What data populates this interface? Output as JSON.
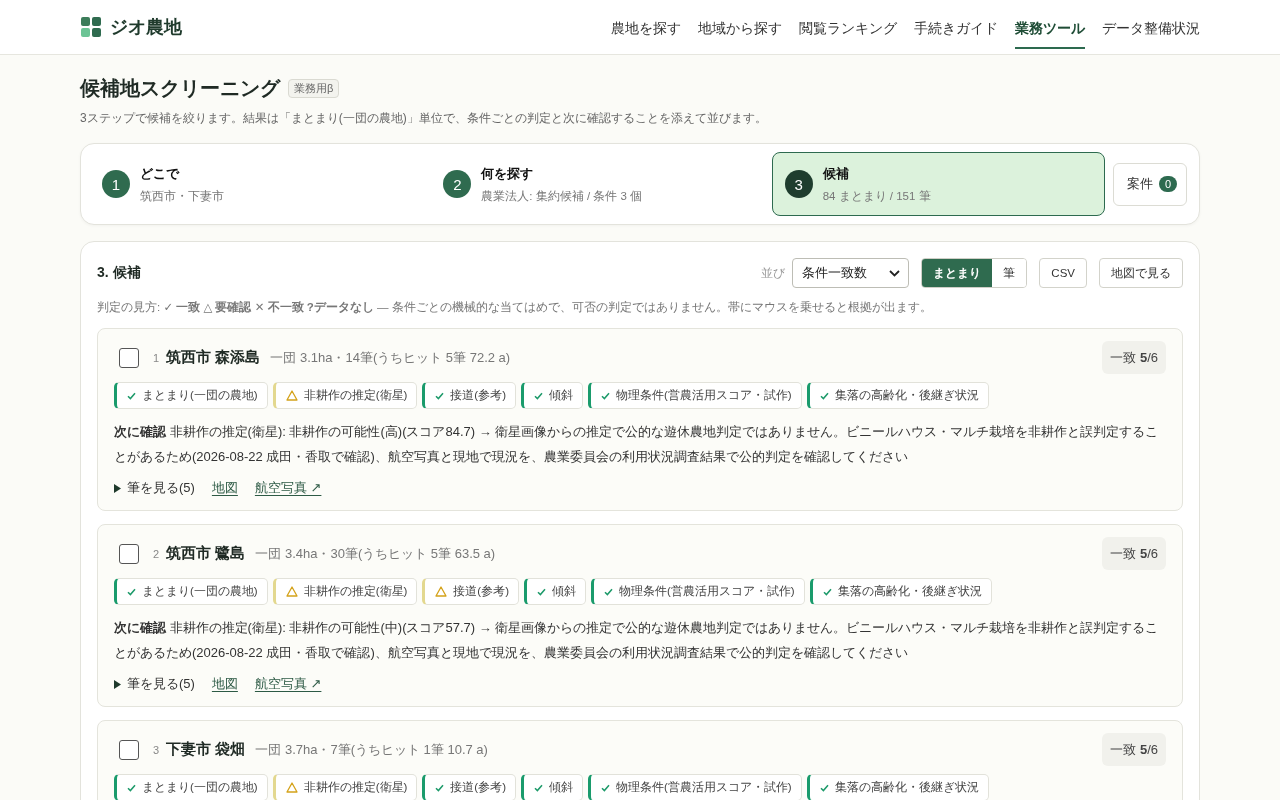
{
  "header": {
    "logo": "ジオ農地",
    "nav": [
      {
        "label": "農地を探す",
        "selected": false
      },
      {
        "label": "地域から探す",
        "selected": false
      },
      {
        "label": "閲覧ランキング",
        "selected": false
      },
      {
        "label": "手続きガイド",
        "selected": false
      },
      {
        "label": "業務ツール",
        "selected": true
      },
      {
        "label": "データ整備状況",
        "selected": false
      }
    ]
  },
  "page": {
    "title": "候補地スクリーニング",
    "badge": "業務用β",
    "description": "3ステップで候補を絞ります。結果は「まとまり(一団の農地)」単位で、条件ごとの判定と次に確認することを添えて並びます。"
  },
  "steps": [
    {
      "number": "1",
      "title": "どこで",
      "detail": "筑西市・下妻市",
      "selected": false
    },
    {
      "number": "2",
      "title": "何を探す",
      "detail": "農業法人: 集約候補 / 条件 3 個",
      "selected": false
    },
    {
      "number": "3",
      "title": "候補",
      "detail": "84 まとまり / 151 筆",
      "selected": true
    }
  ],
  "cases_button": {
    "label": "案件",
    "count": "0"
  },
  "results": {
    "title": "3. 候補",
    "sort": {
      "label": "並び",
      "value": "条件一致数"
    },
    "view_toggle": [
      {
        "label": "まとまり",
        "selected": true
      },
      {
        "label": "筆",
        "selected": false
      }
    ],
    "buttons": [
      "CSV",
      "地図で見る"
    ],
    "legend": "判定の見方: **✓ 一致** **△ 要確認** **✕ 不一致** **?データなし** — 条件ごとの機械的な当てはめで、可否の判定ではありません。帯にマウスを乗せると根拠が出ます。",
    "items": [
      {
        "index": "1",
        "checked": false,
        "name": "筑西市 森添島",
        "meta": "一団 3.1ha・14筆(うちヒット 5筆 72.2 a)",
        "score": "一致 **5**/6",
        "chips": [
          {
            "label": "まとまり(一団の農地)",
            "kind": "match"
          },
          {
            "label": "非耕作の推定(衛星)",
            "kind": "check"
          },
          {
            "label": "接道(参考)",
            "kind": "match"
          },
          {
            "label": "傾斜",
            "kind": "match"
          },
          {
            "label": "物理条件(営農活用スコア・試作)",
            "kind": "match"
          },
          {
            "label": "集落の高齢化・後継ぎ状況",
            "kind": "match"
          }
        ],
        "next_check": "**次に確認** 非耕作の推定(衛星): 非耕作の可能性(高)(スコア84.7) → 衛星画像からの推定で公的な遊休農地判定ではありません。ビニールハウス・マルチ栽培を非耕作と誤判定することがあるため(2026-08-22 成田・香取で確認)、航空写真と現地で現況を、農業委員会の利用状況調査結果で公的判定を確認してください",
        "expand": "筆を見る(5)",
        "map_link": "地図",
        "aerial_photo_link": "航空写真 ↗"
      },
      {
        "index": "2",
        "checked": false,
        "name": "筑西市 鷺島",
        "meta": "一団 3.4ha・30筆(うちヒット 5筆 63.5 a)",
        "score": "一致 **5**/6",
        "chips": [
          {
            "label": "まとまり(一団の農地)",
            "kind": "match"
          },
          {
            "label": "非耕作の推定(衛星)",
            "kind": "check"
          },
          {
            "label": "接道(参考)",
            "kind": "check"
          },
          {
            "label": "傾斜",
            "kind": "match"
          },
          {
            "label": "物理条件(営農活用スコア・試作)",
            "kind": "match"
          },
          {
            "label": "集落の高齢化・後継ぎ状況",
            "kind": "match"
          }
        ],
        "next_check": "**次に確認** 非耕作の推定(衛星): 非耕作の可能性(中)(スコア57.7) → 衛星画像からの推定で公的な遊休農地判定ではありません。ビニールハウス・マルチ栽培を非耕作と誤判定することがあるため(2026-08-22 成田・香取で確認)、航空写真と現地で現況を、農業委員会の利用状況調査結果で公的判定を確認してください",
        "expand": "筆を見る(5)",
        "map_link": "地図",
        "aerial_photo_link": "航空写真 ↗"
      },
      {
        "index": "3",
        "checked": false,
        "name": "下妻市 袋畑",
        "meta": "一団 3.7ha・7筆(うちヒット 1筆 10.7 a)",
        "score": "一致 **5**/6",
        "chips": [
          {
            "label": "まとまり(一団の農地)",
            "kind": "match"
          },
          {
            "label": "非耕作の推定(衛星)",
            "kind": "check"
          },
          {
            "label": "接道(参考)",
            "kind": "match"
          },
          {
            "label": "傾斜",
            "kind": "match"
          },
          {
            "label": "物理条件(営農活用スコア・試作)",
            "kind": "match"
          },
          {
            "label": "集落の高齢化・後継ぎ状況",
            "kind": "match"
          }
        ]
      }
    ]
  }
}
